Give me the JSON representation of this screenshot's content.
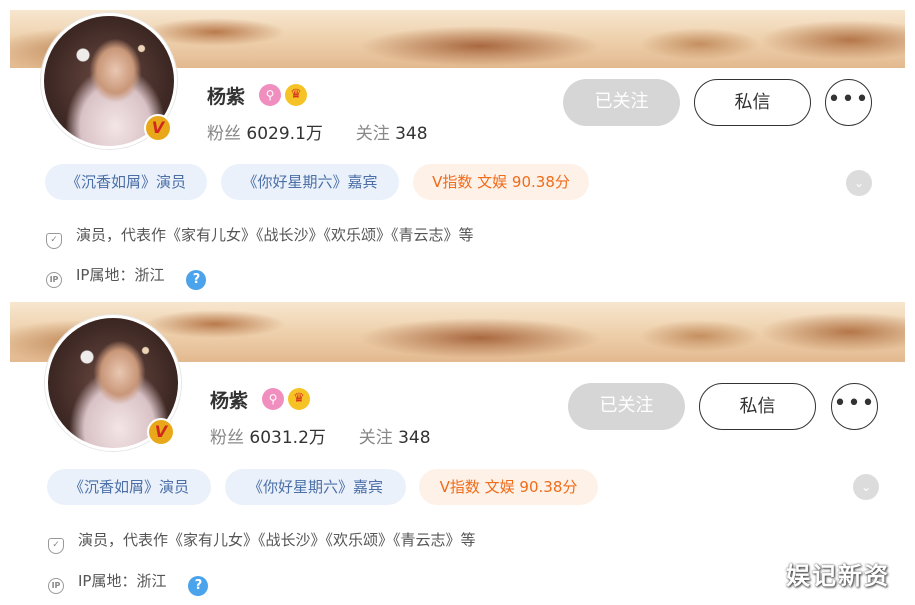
{
  "profiles": [
    {
      "name": "杨紫",
      "fans_label": "粉丝",
      "fans_value": "6029.1万",
      "follow_label": "关注",
      "follow_value": "348",
      "buttons": {
        "followed": "已关注",
        "dm": "私信",
        "more": "•••"
      },
      "tags": [
        "《沉香如屑》演员",
        "《你好星期六》嘉宾",
        "V指数 文娱 90.38分"
      ],
      "description": "演员，代表作《家有儿女》《战长沙》《欢乐颂》《青云志》等",
      "ip_location": "IP属地：浙江",
      "verified_badge": "V"
    },
    {
      "name": "杨紫",
      "fans_label": "粉丝",
      "fans_value": "6031.2万",
      "follow_label": "关注",
      "follow_value": "348",
      "buttons": {
        "followed": "已关注",
        "dm": "私信",
        "more": "•••"
      },
      "tags": [
        "《沉香如屑》演员",
        "《你好星期六》嘉宾",
        "V指数 文娱 90.38分"
      ],
      "description": "演员，代表作《家有儿女》《战长沙》《欢乐颂》《青云志》等",
      "ip_location": "IP属地：浙江",
      "verified_badge": "V"
    }
  ],
  "icons": {
    "help": "?",
    "expand": "⌄",
    "shield": "✓",
    "ip": "IP"
  },
  "watermark": "娱记新资",
  "colors": {
    "tag_blue_bg": "#eaf1fb",
    "tag_blue_text": "#4b6fa6",
    "tag_orange_bg": "#fdf1e8",
    "tag_orange_text": "#f06c1a",
    "followed_button": "#d6d6d6",
    "help_icon": "#4ba3ec"
  }
}
